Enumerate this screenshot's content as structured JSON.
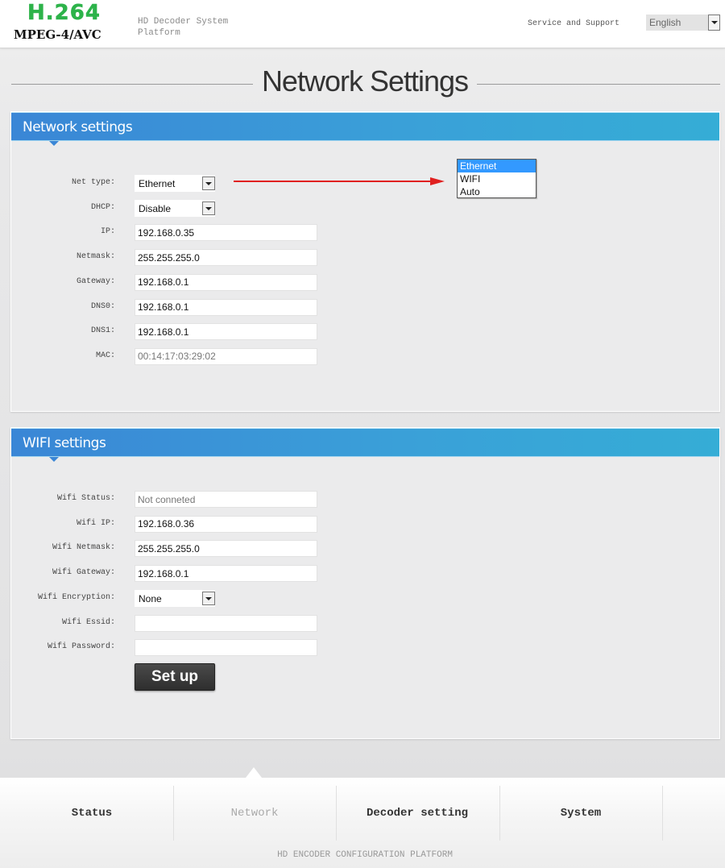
{
  "header": {
    "logo_primary": "H.264",
    "logo_secondary": "MPEG-4/AVC",
    "platform_title": "HD Decoder System Platform",
    "support_link": "Service and Support",
    "language": "English",
    "colors": {
      "logo_green": "#2db34a"
    }
  },
  "page": {
    "title": "Network Settings"
  },
  "network_panel": {
    "title": "Network settings",
    "fields": [
      {
        "label": "Net type:",
        "type": "select",
        "value": "Ethernet"
      },
      {
        "label": "DHCP:",
        "type": "select",
        "value": "Disable"
      },
      {
        "label": "IP:",
        "type": "text",
        "value": "192.168.0.35"
      },
      {
        "label": "Netmask:",
        "type": "text",
        "value": "255.255.255.0"
      },
      {
        "label": "Gateway:",
        "type": "text",
        "value": "192.168.0.1"
      },
      {
        "label": "DNS0:",
        "type": "text",
        "value": "192.168.0.1"
      },
      {
        "label": "DNS1:",
        "type": "text",
        "value": "192.168.0.1"
      },
      {
        "label": "MAC:",
        "type": "text",
        "value": "00:14:17:03:29:02",
        "readonly": true
      }
    ],
    "net_type_options": [
      "Ethernet",
      "WIFI",
      "Auto"
    ],
    "net_type_selected": "Ethernet"
  },
  "wifi_panel": {
    "title": "WIFI settings",
    "fields": [
      {
        "label": "Wifi Status:",
        "type": "text",
        "value": "Not conneted",
        "readonly": true
      },
      {
        "label": "Wifi IP:",
        "type": "text",
        "value": "192.168.0.36"
      },
      {
        "label": "Wifi Netmask:",
        "type": "text",
        "value": "255.255.255.0"
      },
      {
        "label": "Wifi Gateway:",
        "type": "text",
        "value": "192.168.0.1"
      },
      {
        "label": "Wifi Encryption:",
        "type": "select",
        "value": "None"
      },
      {
        "label": "Wifi Essid:",
        "type": "text",
        "value": ""
      },
      {
        "label": "Wifi Password:",
        "type": "text",
        "value": ""
      }
    ],
    "submit_label": "Set up"
  },
  "footer": {
    "nav": [
      {
        "label": "Status",
        "active": false
      },
      {
        "label": "Network",
        "active": true
      },
      {
        "label": "Decoder setting",
        "active": false
      },
      {
        "label": "System",
        "active": false
      }
    ],
    "caption": "HD ENCODER CONFIGURATION PLATFORM"
  },
  "colors": {
    "panel_header_start": "#3a86d6",
    "panel_header_end": "#35add6",
    "annotation_arrow": "#e02020",
    "dropdown_selected": "#3399ff"
  }
}
